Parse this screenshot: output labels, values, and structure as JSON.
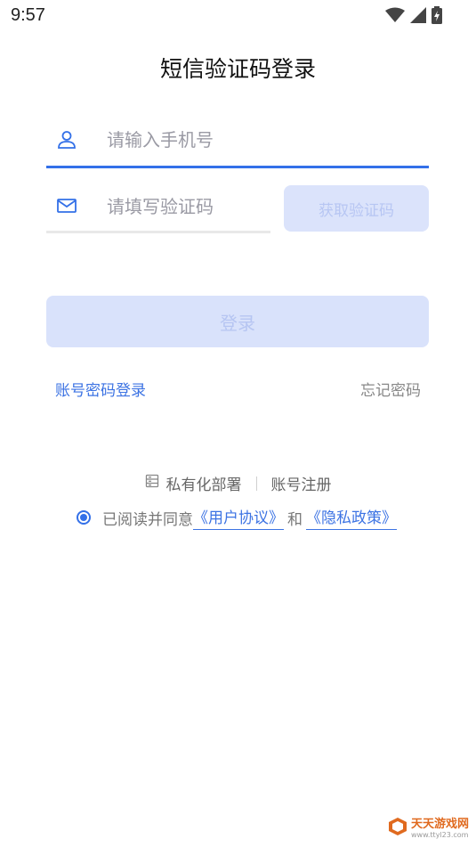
{
  "status_bar": {
    "time": "9:57"
  },
  "page": {
    "title": "短信验证码登录"
  },
  "phone_input": {
    "placeholder": "请输入手机号",
    "value": ""
  },
  "code_input": {
    "placeholder": "请填写验证码",
    "value": ""
  },
  "get_code_button": {
    "label": "获取验证码"
  },
  "login_button": {
    "label": "登录"
  },
  "links": {
    "password_login": "账号密码登录",
    "forgot_password": "忘记密码"
  },
  "bottom": {
    "private_deploy": "私有化部署",
    "register": "账号注册"
  },
  "agreement": {
    "prefix": "已阅读并同意",
    "user_agreement": "《用户协议》",
    "and": "和",
    "privacy_policy": "《隐私政策》",
    "checked": true
  },
  "watermark": {
    "name": "天天游戏网",
    "url": "www.ttyl23.com"
  },
  "colors": {
    "accent": "#3370e8",
    "button_disabled_bg": "#d9e2fb",
    "button_disabled_text": "#b6c5f2"
  },
  "icons": [
    "wifi-icon",
    "cellular-signal-icon",
    "battery-icon",
    "user-icon",
    "mail-icon",
    "server-icon"
  ]
}
